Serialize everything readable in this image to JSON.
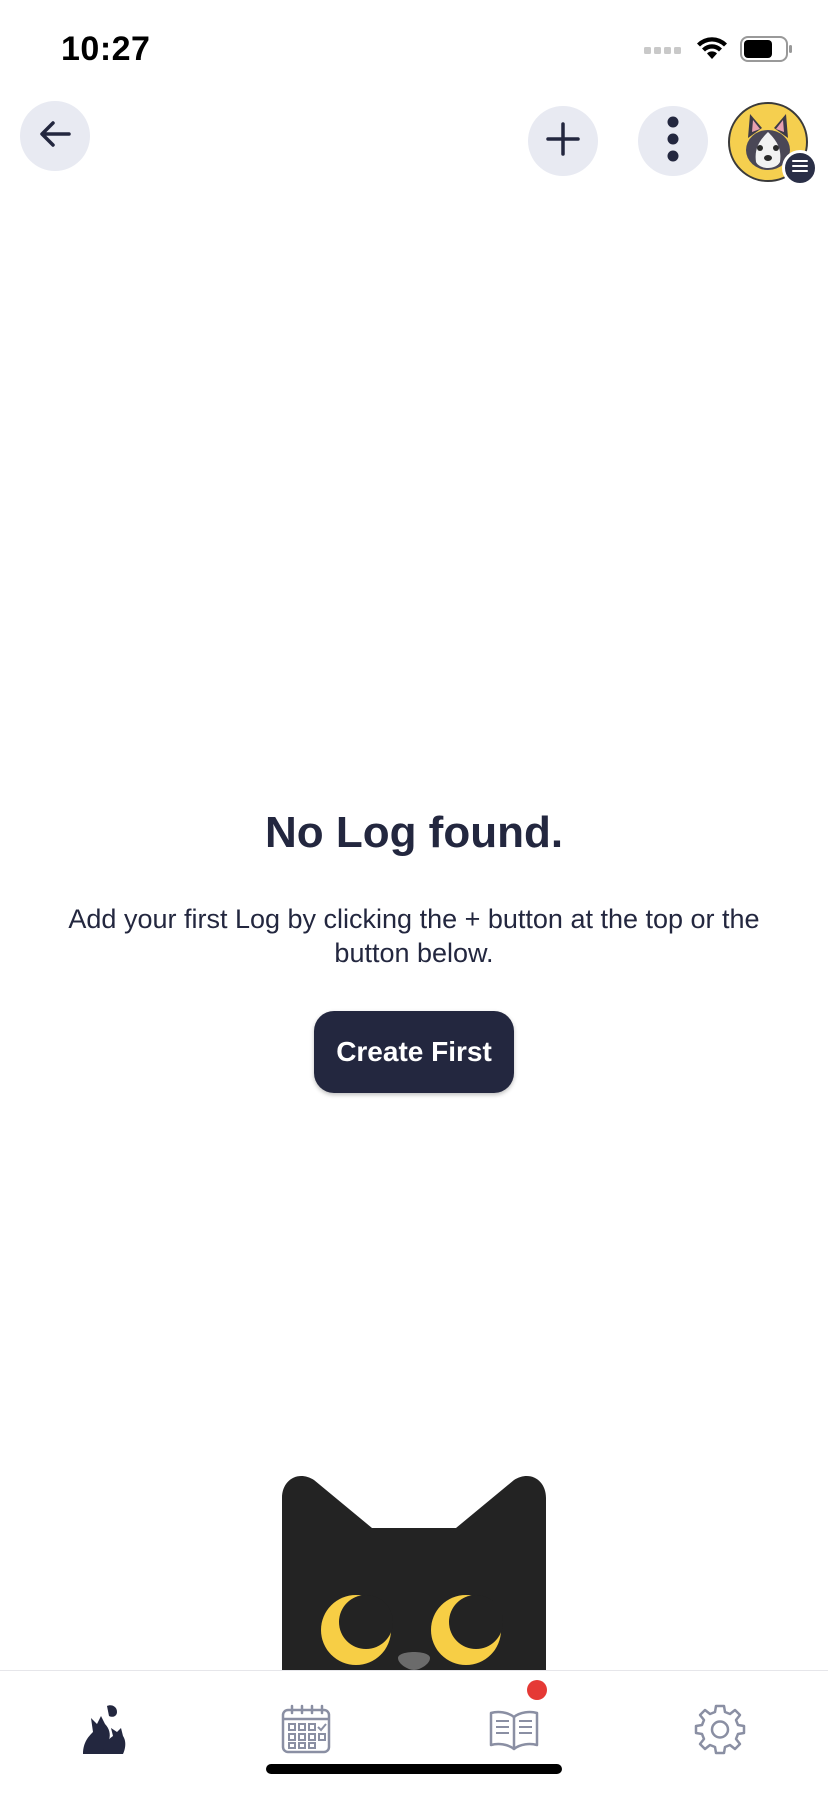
{
  "status_bar": {
    "time": "10:27",
    "icons": [
      "signal-icon",
      "wifi-icon",
      "battery-icon"
    ]
  },
  "top_nav": {
    "back_icon": "arrow-left-icon",
    "add_icon": "plus-icon",
    "more_icon": "more-vertical-icon",
    "avatar": "husky-dog-avatar",
    "avatar_badge_icon": "menu-icon"
  },
  "empty_state": {
    "title": "No Log found.",
    "description": "Add your first Log by clicking the + button at the top or the button below.",
    "button_label": "Create First",
    "illustration": "black-cat-peeking"
  },
  "tab_bar": {
    "tabs": [
      {
        "icon": "pets-icon",
        "active": true
      },
      {
        "icon": "calendar-icon",
        "active": false
      },
      {
        "icon": "book-icon",
        "active": false,
        "has_notification": true
      },
      {
        "icon": "gear-icon",
        "active": false
      }
    ]
  },
  "colors": {
    "primary": "#23273f",
    "button_bg": "#e8eaf2",
    "accent_yellow": "#f5cf4f",
    "notification": "#e53935"
  }
}
